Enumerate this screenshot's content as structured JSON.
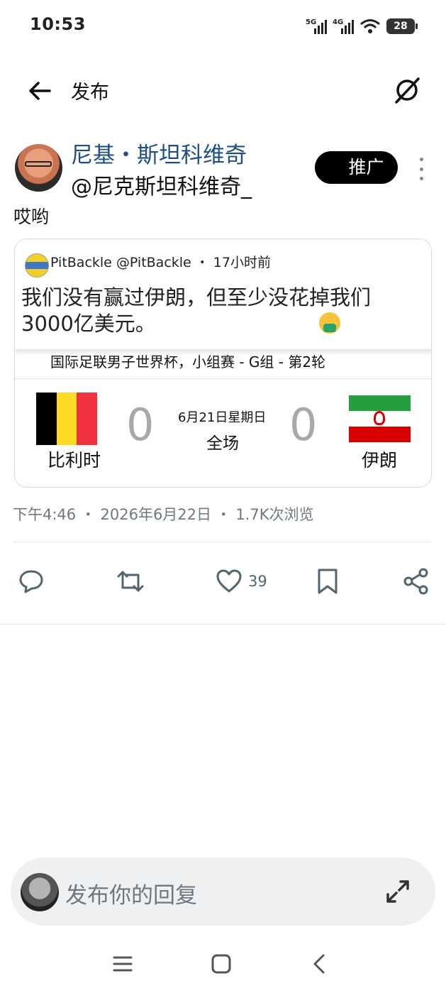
{
  "status": {
    "time": "10:53",
    "net1": "5G",
    "net2": "4G",
    "battery": "28"
  },
  "header": {
    "title": "发布"
  },
  "post": {
    "author_name": "尼基・斯坦科维奇",
    "author_handle": "@尼克斯坦科维奇_",
    "promote_label": "推广",
    "text": "哎哟",
    "meta": "下午4:46 ・ 2026年6月22日 ・ 1.7K次浏览"
  },
  "quote": {
    "name": "PitBackle",
    "handle": "@PitBackle",
    "time": "・ 17小时前",
    "text": "我们没有赢过伊朗，但至少没花掉我们3000亿美元。"
  },
  "match": {
    "competition": "国际足联男子世界杯，小组赛 - G组 - 第2轮",
    "team_left": "比利时",
    "team_right": "伊朗",
    "score_left": "0",
    "score_right": "0",
    "date": "6月21日星期日",
    "status": "全场"
  },
  "actions": {
    "like_count": "39"
  },
  "reply": {
    "placeholder": "发布你的回复"
  },
  "colors": {
    "belgium": [
      "#000000",
      "#FDDA24",
      "#EF3340"
    ],
    "iran": [
      "#239F40",
      "#FFFFFF",
      "#DA0000"
    ]
  }
}
